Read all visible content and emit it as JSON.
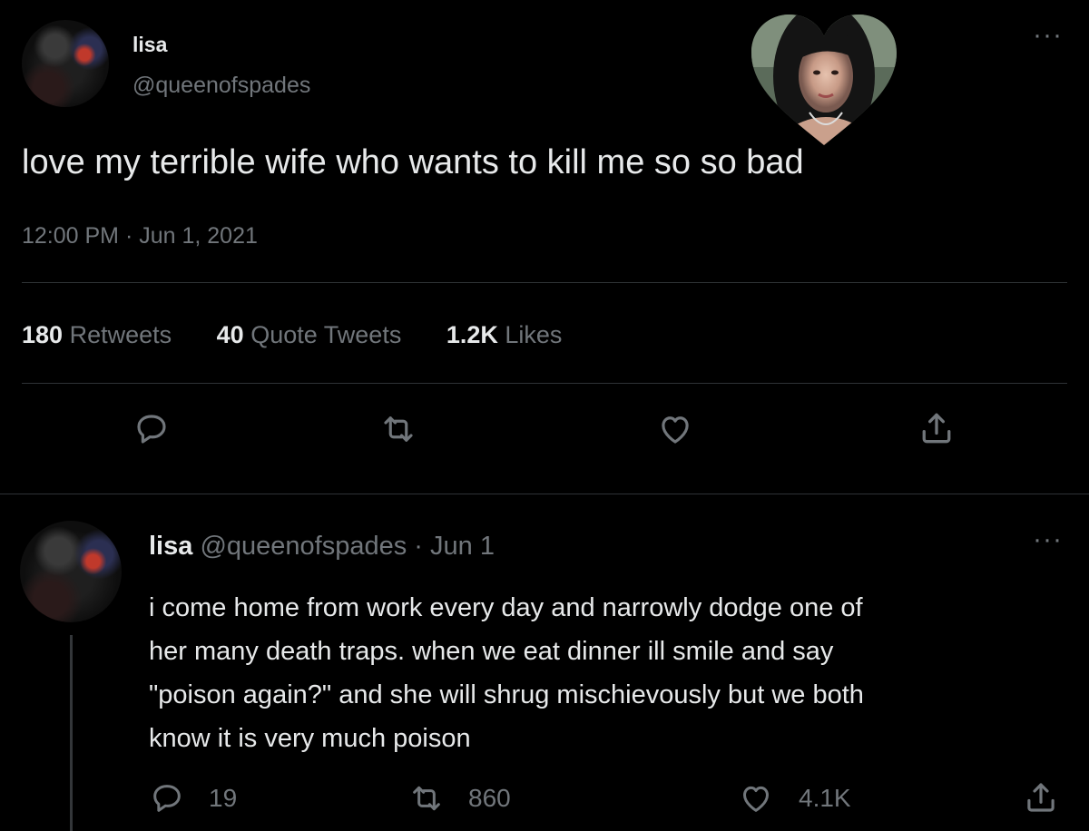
{
  "main_tweet": {
    "display_name": "lisa",
    "handle": "@queenofspades",
    "text": "love my terrible wife who wants to kill me so so bad",
    "timestamp": "12:00 PM · Jun 1, 2021",
    "stats": {
      "retweets_count": "180",
      "retweets_label": "Retweets",
      "quotes_count": "40",
      "quotes_label": "Quote Tweets",
      "likes_count": "1.2K",
      "likes_label": "Likes"
    }
  },
  "reply_tweet": {
    "display_name": "lisa",
    "handle": "@queenofspades",
    "separator": "·",
    "date": "Jun 1",
    "lines": [
      "i come home from work every day and narrowly dodge one of",
      "her many death traps. when we eat dinner ill smile and say",
      "\"poison again?\" and she will shrug mischievously but we both",
      "know it is very much poison"
    ],
    "reply_count": "19",
    "retweet_count": "860",
    "like_count": "4.1K"
  },
  "more_label": "···",
  "colors": {
    "background": "#000000",
    "text": "#e7e9ea",
    "secondary": "#71767b",
    "divider": "#2f3336"
  },
  "icons": [
    "reply-icon",
    "retweet-icon",
    "like-icon",
    "share-icon",
    "more-icon",
    "heart-photo-sticker"
  ]
}
